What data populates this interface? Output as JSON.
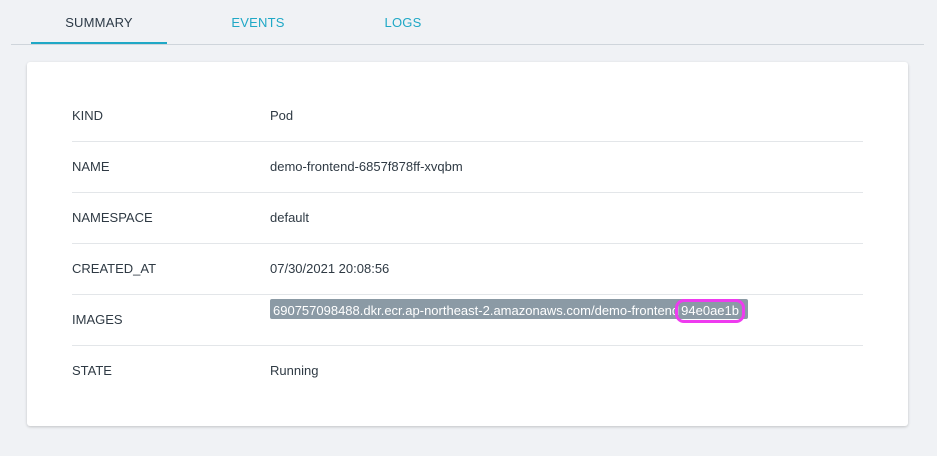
{
  "tabs": [
    {
      "label": "SUMMARY",
      "active": true
    },
    {
      "label": "EVENTS",
      "active": false
    },
    {
      "label": "LOGS",
      "active": false
    }
  ],
  "summary": {
    "rows": [
      {
        "key": "KIND",
        "value": "Pod"
      },
      {
        "key": "NAME",
        "value": "demo-frontend-6857f878ff-xvqbm"
      },
      {
        "key": "NAMESPACE",
        "value": "default"
      },
      {
        "key": "CREATED_AT",
        "value": "07/30/2021 20:08:56"
      },
      {
        "key": "IMAGES",
        "value_prefix": "690757098488.dkr.ecr.ap-northeast-2.amazonaws.com/demo-frontend",
        "value_suffix": "94e0ae1b"
      },
      {
        "key": "STATE",
        "value": "Running"
      }
    ]
  },
  "colors": {
    "accent": "#1fa8c6",
    "highlight": "#ee3bef",
    "chip": "#8b9aa5"
  }
}
